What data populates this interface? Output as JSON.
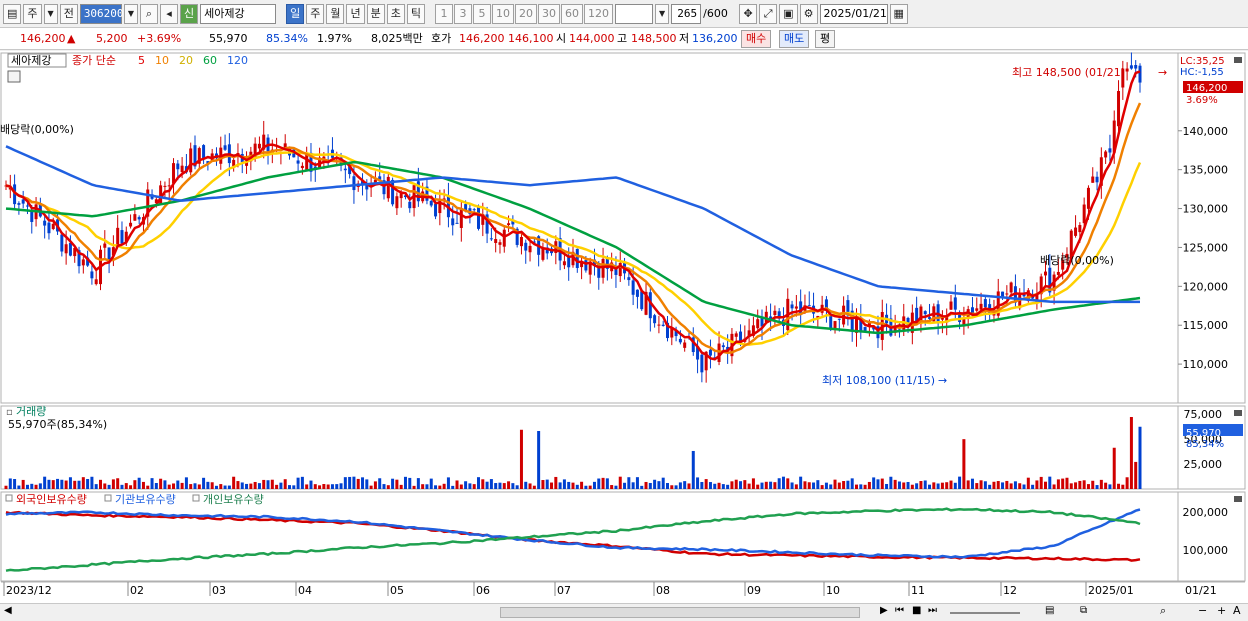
{
  "toolbar": {
    "period": "주",
    "prev": "전",
    "code": "306200",
    "badge": "신",
    "stock_name": "세아제강",
    "tf": [
      {
        "label": "일",
        "active": true
      },
      {
        "label": "주",
        "active": false
      },
      {
        "label": "월",
        "active": false
      },
      {
        "label": "년",
        "active": false
      },
      {
        "label": "분",
        "active": false
      },
      {
        "label": "초",
        "active": false
      },
      {
        "label": "틱",
        "active": false
      }
    ],
    "mins": [
      "1",
      "3",
      "5",
      "10",
      "20",
      "30",
      "60",
      "120"
    ],
    "count": "265",
    "max_count": "/600",
    "date": "2025/01/21"
  },
  "quote": {
    "price": "146,200",
    "arrow": "▲",
    "change": "5,200",
    "change_pct": "+3.69%",
    "volume": "55,970",
    "vol_ratio": "85.34%",
    "turnover": "1.97%",
    "amount": "8,025백만",
    "ask_label": "호가",
    "ask": "146,200",
    "bid": "146,100",
    "open_label": "시",
    "open": "144,000",
    "high_label": "고",
    "high": "148,500",
    "low_label": "저",
    "low": "136,200",
    "buy": "매수",
    "sell": "매도",
    "eval": "평"
  },
  "price_panel": {
    "name": "세아제강",
    "ma_label": "종가 단순",
    "ma_periods": [
      "5",
      "10",
      "20",
      "60",
      "120"
    ],
    "lc": "LC:35,25",
    "hc": "HC:-1,55",
    "last_price": "146,200",
    "last_pct": "3.69%",
    "high_note": "최고 148,500 (01/21)",
    "low_note": "최저 108,100 (11/15)",
    "div1": "배당락(0,00%)",
    "div2": "배당락(0,00%)"
  },
  "volume_panel": {
    "title": "거래량",
    "info": "55,970주(85,34%)",
    "last": "55,970",
    "last_pct": "85,34%"
  },
  "holding_panel": {
    "legend": [
      "외국인보유수량",
      "기관보유수량",
      "개인보유수량"
    ]
  },
  "x_labels": [
    "2023/12",
    "02",
    "03",
    "04",
    "05",
    "06",
    "07",
    "08",
    "09",
    "10",
    "11",
    "12",
    "2025/01"
  ],
  "x_last": "01/21",
  "colors": {
    "up": "#d00000",
    "down": "#0040d0",
    "ma5": "#e00000",
    "ma10": "#f08000",
    "ma20": "#ffd000",
    "ma60": "#00a040",
    "ma120": "#2060e0",
    "foreign": "#d00000",
    "inst": "#2060e0",
    "indiv": "#20a050"
  },
  "chart_data": [
    {
      "type": "line",
      "title": "세아제강 일봉",
      "x": [
        "2023/12",
        "02",
        "03",
        "04",
        "05",
        "06",
        "07",
        "08",
        "09",
        "10",
        "11",
        "12",
        "2025/01"
      ],
      "series": [
        {
          "name": "종가",
          "values": [
            133000,
            122000,
            136000,
            138000,
            134000,
            130000,
            126000,
            122000,
            110000,
            117000,
            115000,
            117000,
            121000,
            146200
          ]
        },
        {
          "name": "60",
          "values": [
            130000,
            129000,
            131000,
            134000,
            136000,
            134000,
            130000,
            125000,
            118000,
            115000,
            114000,
            115000,
            117000,
            118500
          ]
        },
        {
          "name": "120",
          "values": [
            138000,
            133000,
            131000,
            132000,
            133000,
            134000,
            133000,
            134000,
            130000,
            124000,
            120000,
            119000,
            118000,
            118000
          ]
        }
      ],
      "ylim": [
        105000,
        150000
      ],
      "yticks": [
        "140,000",
        "135,000",
        "130,000",
        "125,000",
        "120,000",
        "115,000",
        "110,000"
      ]
    },
    {
      "type": "bar",
      "title": "거래량",
      "yticks": [
        "75,000",
        "50,000",
        "25,000"
      ],
      "ylim": [
        0,
        80000
      ]
    },
    {
      "type": "line",
      "title": "보유수량",
      "series": [
        {
          "name": "외국인보유수량",
          "values": [
            210000,
            200000,
            195000,
            185000,
            175000,
            150000,
            120000,
            100000,
            75000,
            70000,
            65000,
            62000,
            60000,
            55000
          ]
        },
        {
          "name": "기관보유수량",
          "values": [
            205000,
            210000,
            200000,
            195000,
            180000,
            150000,
            120000,
            95000,
            90000,
            80000,
            70000,
            65000,
            100000,
            220000
          ]
        },
        {
          "name": "개인보유수량",
          "values": [
            20000,
            40000,
            60000,
            75000,
            95000,
            110000,
            130000,
            150000,
            180000,
            205000,
            215000,
            220000,
            210000,
            175000
          ]
        }
      ],
      "yticks": [
        "200,000",
        "100,000"
      ],
      "ylim": [
        0,
        250000
      ]
    }
  ]
}
